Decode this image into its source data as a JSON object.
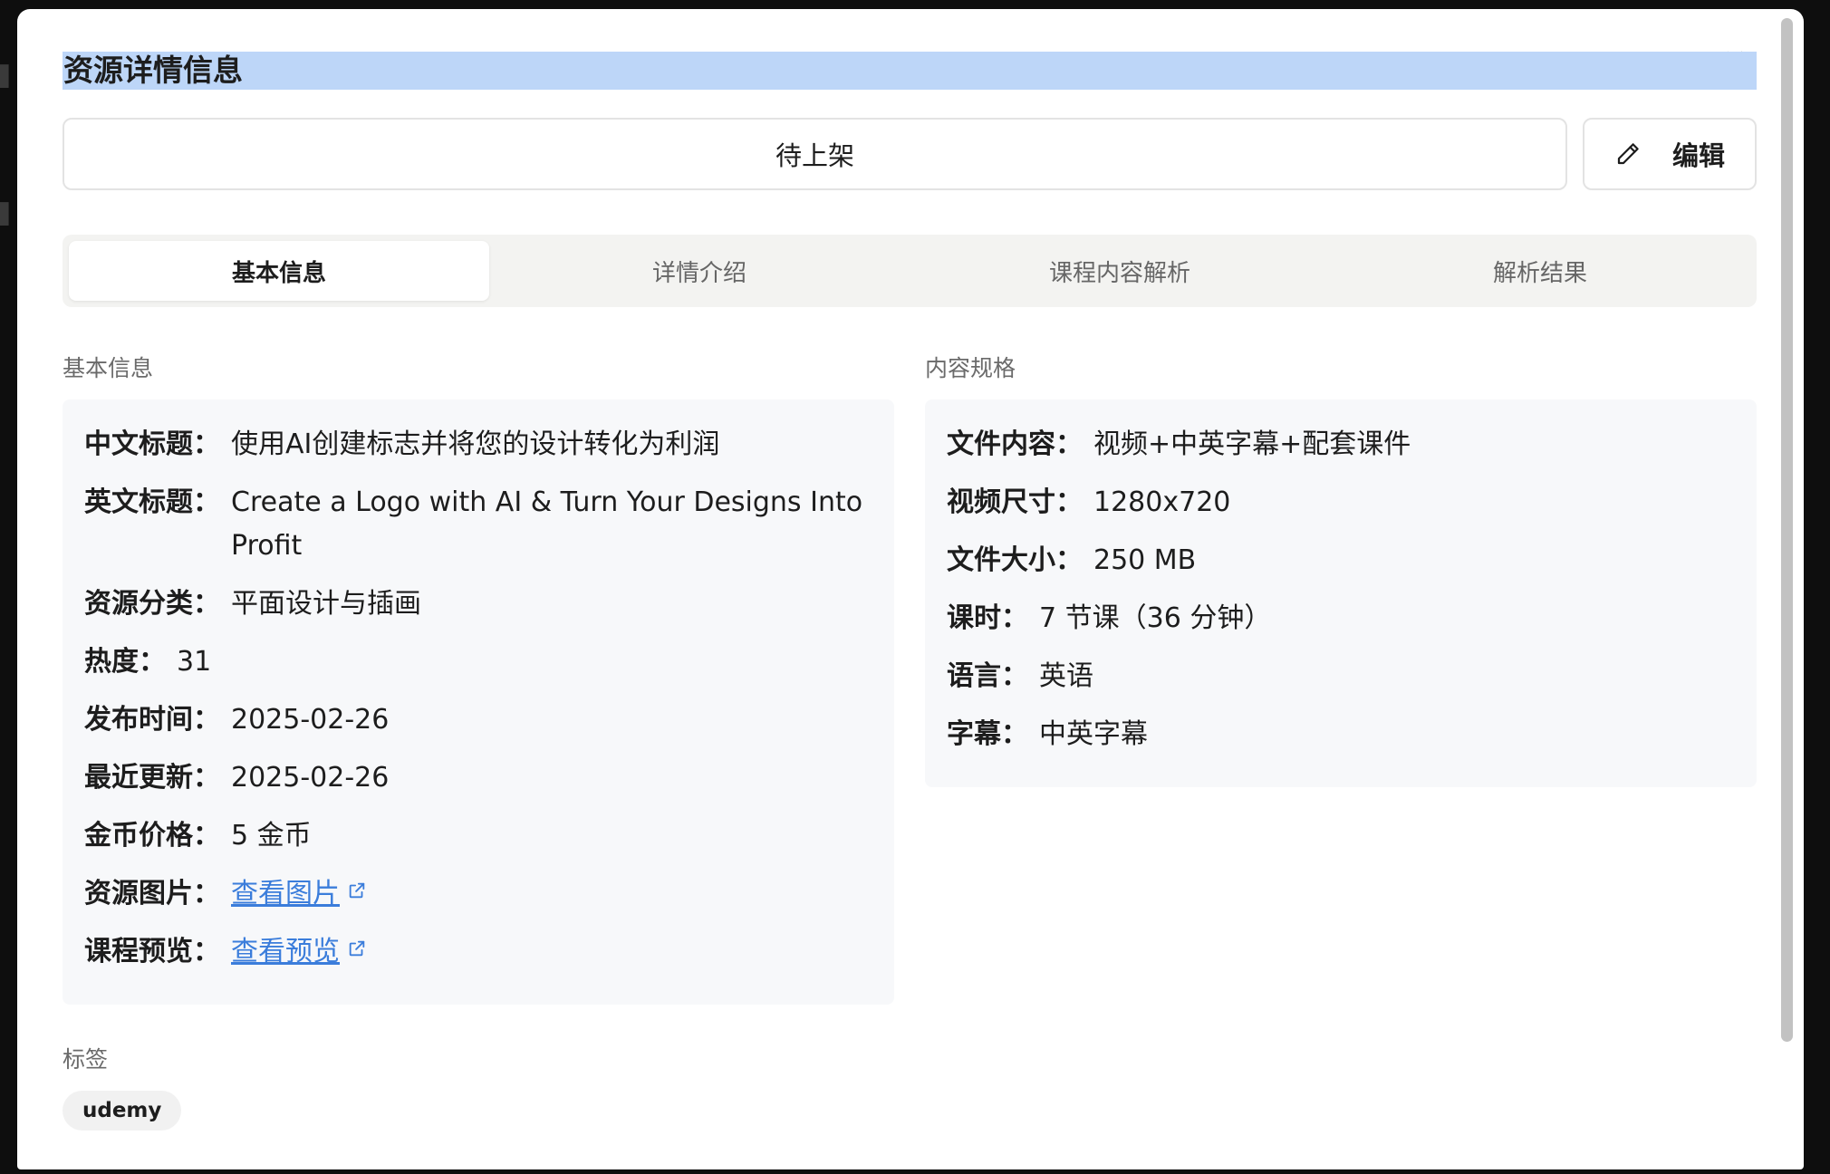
{
  "modal": {
    "title": "资源详情信息",
    "close_icon": "close-icon",
    "status": "待上架",
    "edit_label": "编辑"
  },
  "tabs": [
    {
      "label": "基本信息",
      "active": true
    },
    {
      "label": "详情介绍",
      "active": false
    },
    {
      "label": "课程内容解析",
      "active": false
    },
    {
      "label": "解析结果",
      "active": false
    }
  ],
  "basic": {
    "section_title": "基本信息",
    "cn_title_label": "中文标题：",
    "cn_title": "使用AI创建标志并将您的设计转化为利润",
    "en_title_label": "英文标题：",
    "en_title": "Create a Logo with AI & Turn Your Designs Into Profit",
    "category_label": "资源分类：",
    "category": "平面设计与插画",
    "heat_label": "热度：",
    "heat": "31",
    "publish_label": "发布时间：",
    "publish": "2025-02-26",
    "updated_label": "最近更新：",
    "updated": "2025-02-26",
    "price_label": "金币价格：",
    "price": "5 金币",
    "image_label": "资源图片：",
    "image_link": "查看图片",
    "preview_label": "课程预览：",
    "preview_link": "查看预览"
  },
  "spec": {
    "section_title": "内容规格",
    "file_content_label": "文件内容：",
    "file_content": "视频+中英字幕+配套课件",
    "video_size_label": "视频尺寸：",
    "video_size": "1280x720",
    "file_size_label": "文件大小：",
    "file_size": "250 MB",
    "lessons_label": "课时：",
    "lessons": "7 节课（36 分钟）",
    "language_label": "语言：",
    "language": "英语",
    "subtitle_label": "字幕：",
    "subtitle": "中英字幕"
  },
  "tags": {
    "section_title": "标签",
    "items": [
      "udemy"
    ]
  }
}
